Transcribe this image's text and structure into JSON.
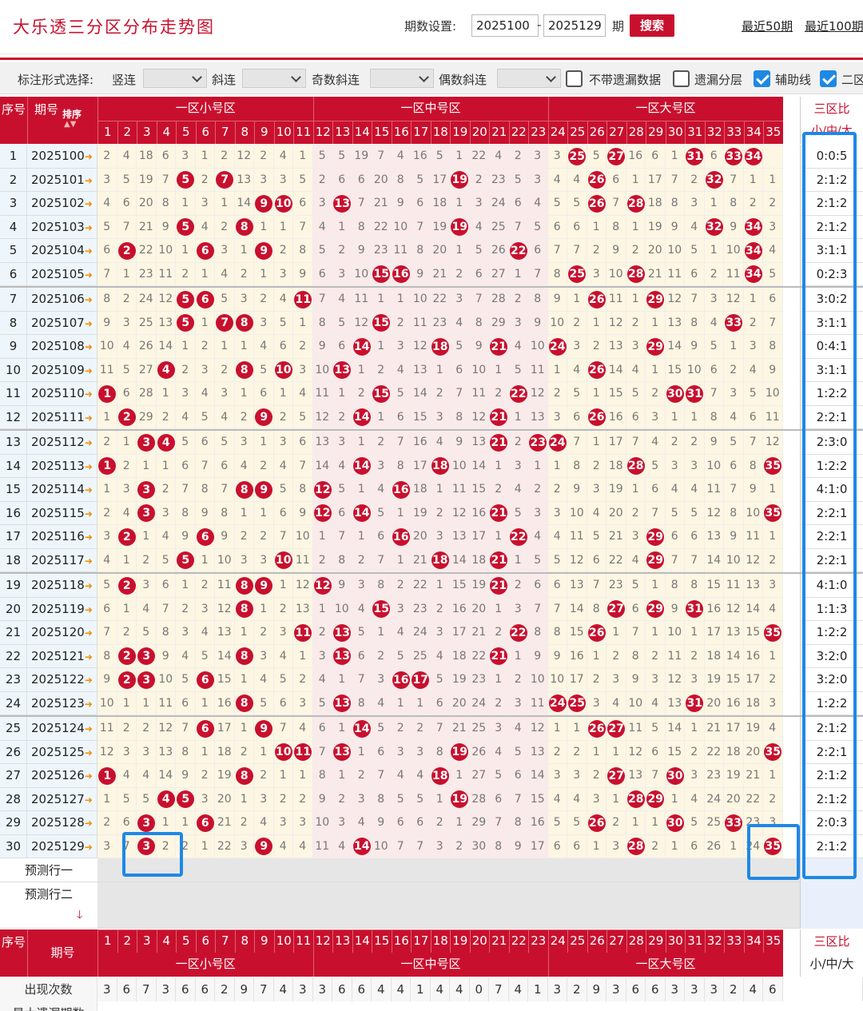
{
  "header": {
    "title": "大乐透三分区分布走势图",
    "period_setting_label": "期数设置:",
    "from_value": "2025100",
    "dash": "-",
    "to_value": "2025129",
    "period_unit": "期",
    "search_label": "搜索",
    "recent50": "最近50期",
    "recent100": "最近100期"
  },
  "options": {
    "mode_label": "标注形式选择:",
    "vertical": "竖连",
    "diagonal": "斜连",
    "odd_diagonal": "奇数斜连",
    "even_diagonal": "偶数斜连",
    "no_missing": "不带遗漏数据",
    "no_missing_checked": false,
    "missing_layer": "遗漏分层",
    "missing_layer_checked": false,
    "aux_line": "辅助线",
    "aux_line_checked": true,
    "zone2": "二区",
    "zone2_checked": true
  },
  "table_header": {
    "seq": "序号",
    "period": "期号",
    "sort": "排序",
    "zone1": "一区小号区",
    "zone2": "一区中号区",
    "zone3": "一区大号区",
    "ratio_title": "三区比",
    "ratio_sub": "小/中/大",
    "numbers": [
      "1",
      "2",
      "3",
      "4",
      "5",
      "6",
      "7",
      "8",
      "9",
      "10",
      "11",
      "12",
      "13",
      "14",
      "15",
      "16",
      "17",
      "18",
      "19",
      "20",
      "21",
      "22",
      "23",
      "24",
      "25",
      "26",
      "27",
      "28",
      "29",
      "30",
      "31",
      "32",
      "33",
      "34",
      "35"
    ]
  },
  "rows": [
    {
      "seq": "1",
      "period": "2025100",
      "cells": [
        2,
        4,
        18,
        6,
        3,
        1,
        2,
        12,
        2,
        4,
        1,
        5,
        5,
        19,
        7,
        4,
        16,
        5,
        1,
        22,
        4,
        2,
        3,
        3,
        "B",
        5,
        "B",
        16,
        6,
        1,
        "B",
        6,
        "B",
        "B"
      ],
      "ratio": "0:0:5"
    },
    {
      "seq": "2",
      "period": "2025101",
      "cells": [
        3,
        5,
        19,
        7,
        "B",
        2,
        "B",
        13,
        3,
        3,
        5,
        2,
        6,
        6,
        20,
        8,
        5,
        17,
        "B",
        2,
        23,
        5,
        3,
        4,
        4,
        "B",
        6,
        1,
        17,
        7,
        2,
        "B",
        7,
        1,
        1
      ],
      "ratio": "2:1:2"
    },
    {
      "seq": "3",
      "period": "2025102",
      "cells": [
        4,
        6,
        20,
        8,
        1,
        3,
        1,
        14,
        "B",
        "B",
        6,
        3,
        "B",
        7,
        21,
        9,
        6,
        18,
        1,
        3,
        24,
        6,
        4,
        5,
        5,
        "B",
        7,
        "B",
        18,
        8,
        3,
        1,
        8,
        2,
        2
      ],
      "ratio": "2:1:2"
    },
    {
      "seq": "4",
      "period": "2025103",
      "cells": [
        5,
        7,
        21,
        9,
        "B",
        4,
        2,
        "B",
        1,
        1,
        7,
        4,
        1,
        8,
        22,
        10,
        7,
        19,
        "B",
        4,
        25,
        7,
        5,
        6,
        6,
        1,
        8,
        1,
        19,
        9,
        4,
        "B",
        9,
        "B",
        3
      ],
      "ratio": "2:1:2"
    },
    {
      "seq": "5",
      "period": "2025104",
      "cells": [
        6,
        "B",
        22,
        10,
        1,
        "B",
        3,
        1,
        "B",
        2,
        8,
        5,
        2,
        9,
        23,
        11,
        8,
        20,
        1,
        5,
        26,
        "B",
        6,
        7,
        7,
        2,
        9,
        2,
        20,
        10,
        5,
        1,
        10,
        "B",
        4
      ],
      "ratio": "3:1:1"
    },
    {
      "seq": "6",
      "period": "2025105",
      "cells": [
        7,
        1,
        23,
        11,
        2,
        1,
        4,
        2,
        1,
        3,
        9,
        6,
        3,
        10,
        "B",
        "B",
        9,
        21,
        2,
        6,
        27,
        1,
        7,
        8,
        "B",
        3,
        10,
        "B",
        21,
        11,
        6,
        2,
        11,
        "B",
        5
      ],
      "ratio": "0:2:3"
    },
    {
      "seq": "7",
      "period": "2025106",
      "cells": [
        8,
        2,
        24,
        12,
        "B",
        "B",
        5,
        3,
        2,
        4,
        "B",
        7,
        4,
        11,
        1,
        1,
        10,
        22,
        3,
        7,
        28,
        2,
        8,
        9,
        1,
        "B",
        11,
        1,
        "B",
        12,
        7,
        3,
        12,
        1,
        6
      ],
      "ratio": "3:0:2"
    },
    {
      "seq": "8",
      "period": "2025107",
      "cells": [
        9,
        3,
        25,
        13,
        "B",
        1,
        "B",
        "B",
        3,
        5,
        1,
        8,
        5,
        12,
        "B",
        2,
        11,
        23,
        4,
        8,
        29,
        3,
        9,
        10,
        2,
        1,
        12,
        2,
        1,
        13,
        8,
        4,
        "B",
        2,
        7
      ],
      "ratio": "3:1:1"
    },
    {
      "seq": "9",
      "period": "2025108",
      "cells": [
        10,
        4,
        26,
        14,
        1,
        2,
        1,
        1,
        4,
        6,
        2,
        9,
        6,
        "B",
        1,
        3,
        12,
        "B",
        5,
        9,
        "B",
        4,
        10,
        "B",
        3,
        2,
        13,
        3,
        "B",
        14,
        9,
        5,
        1,
        3,
        8
      ],
      "ratio": "0:4:1"
    },
    {
      "seq": "10",
      "period": "2025109",
      "cells": [
        11,
        5,
        27,
        "B",
        2,
        3,
        2,
        "B",
        5,
        "B",
        3,
        10,
        "B",
        1,
        2,
        4,
        13,
        1,
        6,
        10,
        1,
        5,
        11,
        1,
        4,
        "B",
        14,
        4,
        1,
        15,
        10,
        6,
        2,
        4,
        9
      ],
      "ratio": "3:1:1"
    },
    {
      "seq": "11",
      "period": "2025110",
      "cells": [
        "B",
        6,
        28,
        1,
        3,
        4,
        3,
        1,
        6,
        1,
        4,
        11,
        1,
        2,
        "B",
        5,
        14,
        2,
        7,
        11,
        2,
        "B",
        12,
        2,
        5,
        1,
        15,
        5,
        2,
        "B",
        "B",
        7,
        3,
        5,
        10
      ],
      "ratio": "1:2:2"
    },
    {
      "seq": "12",
      "period": "2025111",
      "cells": [
        1,
        "B",
        29,
        2,
        4,
        5,
        4,
        2,
        "B",
        2,
        5,
        12,
        2,
        "B",
        1,
        6,
        15,
        3,
        8,
        12,
        "B",
        1,
        13,
        3,
        6,
        "B",
        16,
        6,
        3,
        1,
        1,
        8,
        4,
        6,
        11
      ],
      "ratio": "2:2:1"
    },
    {
      "seq": "13",
      "period": "2025112",
      "cells": [
        2,
        1,
        "B",
        "B",
        5,
        6,
        5,
        3,
        1,
        3,
        6,
        13,
        3,
        1,
        2,
        7,
        16,
        4,
        9,
        13,
        "B",
        2,
        "B",
        "B",
        7,
        1,
        17,
        7,
        4,
        2,
        2,
        9,
        5,
        7,
        12
      ],
      "ratio": "2:3:0"
    },
    {
      "seq": "14",
      "period": "2025113",
      "cells": [
        "B",
        2,
        1,
        1,
        6,
        7,
        6,
        4,
        2,
        4,
        7,
        14,
        4,
        "B",
        3,
        8,
        17,
        "B",
        10,
        14,
        1,
        3,
        1,
        1,
        8,
        2,
        18,
        "B",
        5,
        3,
        3,
        10,
        6,
        8,
        "B"
      ],
      "ratio": "1:2:2"
    },
    {
      "seq": "15",
      "period": "2025114",
      "cells": [
        1,
        3,
        "B",
        2,
        7,
        8,
        7,
        "B",
        "B",
        5,
        8,
        "B",
        5,
        1,
        4,
        "B",
        18,
        1,
        11,
        15,
        2,
        4,
        2,
        2,
        9,
        3,
        19,
        1,
        6,
        4,
        4,
        11,
        7,
        9,
        1
      ],
      "ratio": "4:1:0"
    },
    {
      "seq": "16",
      "period": "2025115",
      "cells": [
        2,
        4,
        "B",
        3,
        8,
        9,
        8,
        1,
        1,
        6,
        9,
        "B",
        6,
        "B",
        5,
        1,
        19,
        2,
        12,
        16,
        "B",
        5,
        3,
        3,
        10,
        4,
        20,
        2,
        7,
        5,
        5,
        12,
        8,
        10,
        "B"
      ],
      "ratio": "2:2:1"
    },
    {
      "seq": "17",
      "period": "2025116",
      "cells": [
        3,
        "B",
        1,
        4,
        9,
        "B",
        9,
        2,
        2,
        7,
        10,
        1,
        7,
        1,
        6,
        "B",
        20,
        3,
        13,
        17,
        1,
        "B",
        4,
        4,
        11,
        5,
        21,
        3,
        "B",
        6,
        6,
        13,
        9,
        11,
        1
      ],
      "ratio": "2:2:1"
    },
    {
      "seq": "18",
      "period": "2025117",
      "cells": [
        4,
        1,
        2,
        5,
        "B",
        1,
        10,
        3,
        3,
        "B",
        11,
        2,
        8,
        2,
        7,
        1,
        21,
        "B",
        14,
        18,
        "B",
        1,
        5,
        5,
        12,
        6,
        22,
        4,
        "B",
        7,
        7,
        14,
        10,
        12,
        2
      ],
      "ratio": "2:2:1"
    },
    {
      "seq": "19",
      "period": "2025118",
      "cells": [
        5,
        "B",
        3,
        6,
        1,
        2,
        11,
        "B",
        "B",
        1,
        12,
        "B",
        9,
        3,
        8,
        2,
        22,
        1,
        15,
        19,
        "B",
        2,
        6,
        6,
        13,
        7,
        23,
        5,
        1,
        8,
        8,
        15,
        11,
        13,
        3
      ],
      "ratio": "4:1:0"
    },
    {
      "seq": "20",
      "period": "2025119",
      "cells": [
        6,
        1,
        4,
        7,
        2,
        3,
        12,
        "B",
        1,
        2,
        13,
        1,
        10,
        4,
        "B",
        3,
        23,
        2,
        16,
        20,
        1,
        3,
        7,
        7,
        14,
        8,
        "B",
        6,
        "B",
        9,
        "B",
        16,
        12,
        14,
        4
      ],
      "ratio": "1:1:3"
    },
    {
      "seq": "21",
      "period": "2025120",
      "cells": [
        7,
        2,
        5,
        8,
        3,
        4,
        13,
        1,
        2,
        3,
        "B",
        2,
        "B",
        5,
        1,
        4,
        24,
        3,
        17,
        21,
        2,
        "B",
        8,
        8,
        15,
        "B",
        1,
        7,
        1,
        10,
        1,
        17,
        13,
        15,
        "B"
      ],
      "ratio": "1:2:2"
    },
    {
      "seq": "22",
      "period": "2025121",
      "cells": [
        8,
        "B",
        "B",
        9,
        4,
        5,
        14,
        "B",
        3,
        4,
        1,
        3,
        "B",
        6,
        2,
        5,
        25,
        4,
        18,
        22,
        "B",
        1,
        9,
        9,
        16,
        1,
        2,
        8,
        2,
        11,
        2,
        18,
        14,
        16,
        1
      ],
      "ratio": "3:2:0"
    },
    {
      "seq": "23",
      "period": "2025122",
      "cells": [
        9,
        "B",
        "B",
        10,
        5,
        "B",
        15,
        1,
        4,
        5,
        2,
        4,
        1,
        7,
        3,
        "B",
        "B",
        5,
        19,
        23,
        1,
        2,
        10,
        10,
        17,
        2,
        3,
        9,
        3,
        12,
        3,
        19,
        15,
        17,
        2
      ],
      "ratio": "3:2:0"
    },
    {
      "seq": "24",
      "period": "2025123",
      "cells": [
        10,
        1,
        1,
        11,
        6,
        1,
        16,
        "B",
        5,
        6,
        3,
        5,
        "B",
        8,
        4,
        1,
        1,
        6,
        20,
        24,
        2,
        3,
        11,
        "B",
        "B",
        3,
        4,
        10,
        4,
        13,
        "B",
        20,
        16,
        18,
        3
      ],
      "ratio": "1:2:2"
    },
    {
      "seq": "25",
      "period": "2025124",
      "cells": [
        11,
        2,
        2,
        12,
        7,
        "B",
        17,
        1,
        "B",
        7,
        4,
        6,
        1,
        "B",
        5,
        2,
        2,
        7,
        21,
        25,
        3,
        4,
        12,
        1,
        1,
        "B",
        "B",
        11,
        5,
        14,
        1,
        21,
        17,
        19,
        4
      ],
      "ratio": "2:1:2"
    },
    {
      "seq": "26",
      "period": "2025125",
      "cells": [
        12,
        3,
        3,
        13,
        8,
        1,
        18,
        2,
        1,
        "B",
        "B",
        7,
        "B",
        1,
        6,
        3,
        3,
        8,
        "B",
        26,
        4,
        5,
        13,
        2,
        2,
        1,
        1,
        12,
        6,
        15,
        2,
        22,
        18,
        20,
        "B"
      ],
      "ratio": "2:2:1"
    },
    {
      "seq": "27",
      "period": "2025126",
      "cells": [
        "B",
        4,
        4,
        14,
        9,
        2,
        19,
        "B",
        2,
        1,
        1,
        8,
        1,
        2,
        7,
        4,
        4,
        "B",
        1,
        27,
        5,
        6,
        14,
        3,
        3,
        2,
        "B",
        13,
        7,
        "B",
        3,
        23,
        19,
        21,
        1
      ],
      "ratio": "2:1:2"
    },
    {
      "seq": "28",
      "period": "2025127",
      "cells": [
        1,
        5,
        5,
        "B",
        "B",
        3,
        20,
        1,
        3,
        2,
        2,
        9,
        2,
        3,
        8,
        5,
        5,
        1,
        "B",
        28,
        6,
        7,
        15,
        4,
        4,
        3,
        1,
        "B",
        "B",
        1,
        4,
        24,
        20,
        22,
        2
      ],
      "ratio": "2:1:2"
    },
    {
      "seq": "29",
      "period": "2025128",
      "cells": [
        2,
        6,
        "B",
        1,
        1,
        "B",
        21,
        2,
        4,
        3,
        3,
        10,
        3,
        4,
        9,
        6,
        6,
        2,
        1,
        29,
        7,
        8,
        16,
        5,
        5,
        "B",
        2,
        1,
        1,
        "B",
        5,
        25,
        "B",
        23,
        3
      ],
      "ratio": "2:0:3"
    },
    {
      "seq": "30",
      "period": "2025129",
      "cells": [
        3,
        7,
        "B",
        2,
        2,
        1,
        22,
        3,
        "B",
        4,
        4,
        11,
        4,
        "B",
        10,
        7,
        7,
        3,
        2,
        30,
        8,
        9,
        17,
        6,
        6,
        1,
        3,
        "B",
        2,
        1,
        6,
        26,
        1,
        24,
        "B"
      ],
      "ratio": "2:1:2"
    }
  ],
  "predict": {
    "row1": "预测行一",
    "row2": "预测行二"
  },
  "footer": {
    "count_label": "出现次数",
    "counts": [
      "3",
      "6",
      "7",
      "3",
      "6",
      "6",
      "2",
      "9",
      "7",
      "4",
      "3",
      "3",
      "6",
      "6",
      "4",
      "4",
      "1",
      "4",
      "4",
      "0",
      "7",
      "4",
      "1",
      "3",
      "2",
      "9",
      "3",
      "6",
      "6",
      "3",
      "3",
      "3",
      "2",
      "4",
      "6"
    ],
    "max_missing_label": "最大遗漏期数"
  },
  "colors": {
    "brand_red": "#c8102e",
    "highlight_blue": "#1e88e5",
    "arrow_orange": "#f08c00"
  }
}
